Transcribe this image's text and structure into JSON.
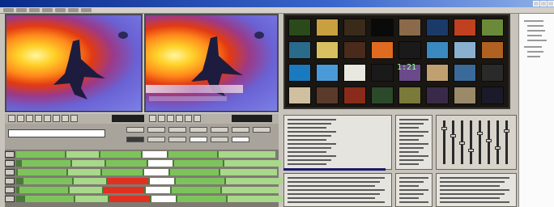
{
  "window": {
    "title": ""
  },
  "menu": {
    "items": [
      "",
      "",
      "",
      "",
      "",
      "",
      "",
      ""
    ]
  },
  "colors": {
    "titlebar": "#0a2a8a",
    "timeline_clip": "#7cc45a",
    "selected_clip": "#e03020",
    "panel": "#c8c4bc"
  },
  "icons": [
    "minimize-icon",
    "maximize-icon",
    "close-icon",
    "play-icon",
    "stop-icon",
    "rewind-icon",
    "fast-forward-icon"
  ],
  "timecode": {
    "value": ""
  },
  "thumbnails": {
    "display_text": "1:21"
  },
  "timeline": {
    "tracks": 6
  }
}
